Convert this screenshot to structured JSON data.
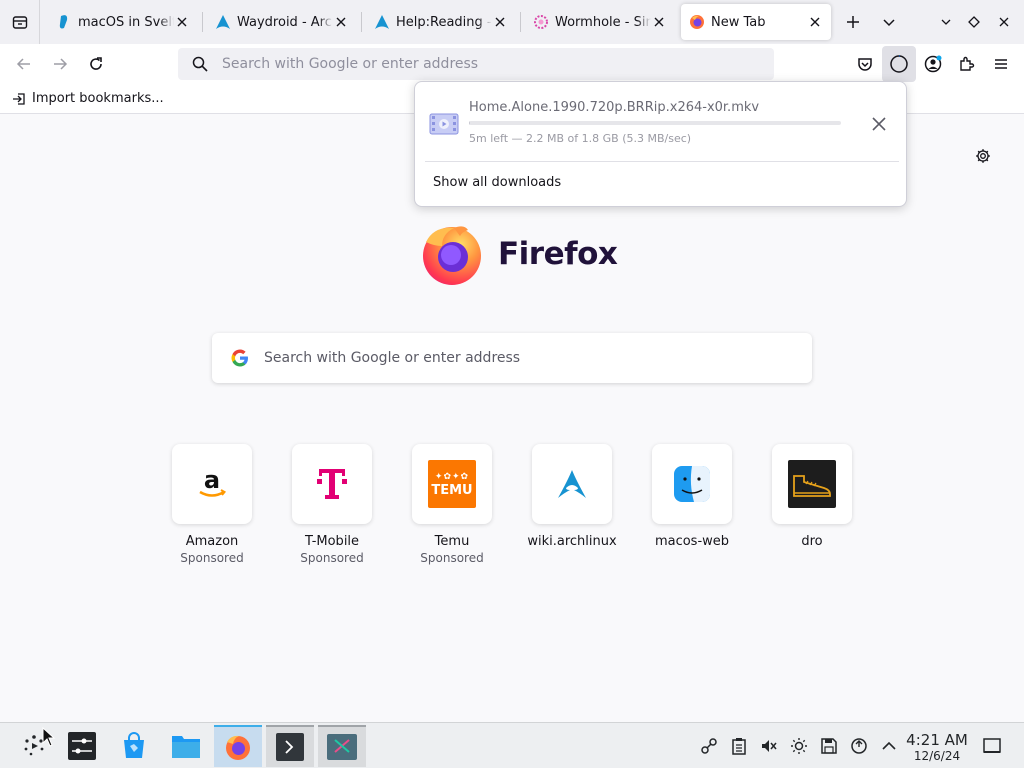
{
  "tabs": [
    {
      "title": "macOS in Svelte",
      "icon": "svelte-icon",
      "active": false
    },
    {
      "title": "Waydroid - ArchWiki",
      "icon": "arch-icon",
      "active": false
    },
    {
      "title": "Help:Reading - ArchWiki",
      "icon": "arch-icon",
      "active": false
    },
    {
      "title": "Wormhole - Simple",
      "icon": "wormhole-icon",
      "active": false
    },
    {
      "title": "New Tab",
      "icon": "firefox-icon",
      "active": true
    }
  ],
  "navbar": {
    "url_placeholder": "Search with Google or enter address"
  },
  "bookmarks": {
    "import_label": "Import bookmarks..."
  },
  "downloads": {
    "filename": "Home.Alone.1990.720p.BRRip.x264-x0r.mkv",
    "status": "5m left — 2.2 MB of 1.8 GB (5.3 MB/sec)",
    "progress": 0.0012,
    "show_all_label": "Show all downloads"
  },
  "newtab": {
    "brand": "Firefox",
    "search_placeholder": "Search with Google or enter address",
    "tiles": [
      {
        "label": "Amazon",
        "sub": "Sponsored",
        "icon": "amazon-icon"
      },
      {
        "label": "T-Mobile",
        "sub": "Sponsored",
        "icon": "tmobile-icon"
      },
      {
        "label": "Temu",
        "sub": "Sponsored",
        "icon": "temu-icon"
      },
      {
        "label": "wiki.archlinux",
        "sub": "",
        "icon": "arch-icon"
      },
      {
        "label": "macos-web",
        "sub": "",
        "icon": "finder-icon"
      },
      {
        "label": "dro",
        "sub": "",
        "icon": "shoe-icon"
      }
    ],
    "temu_logo_text": "TEMU"
  },
  "taskbar": {
    "time": "4:21 AM",
    "date": "12/6/24"
  },
  "colors": {
    "accent": "#0060df",
    "firefox_orange": "#ff7139",
    "arch_blue": "#1793d1",
    "taskbar_active": "#3daee9"
  }
}
